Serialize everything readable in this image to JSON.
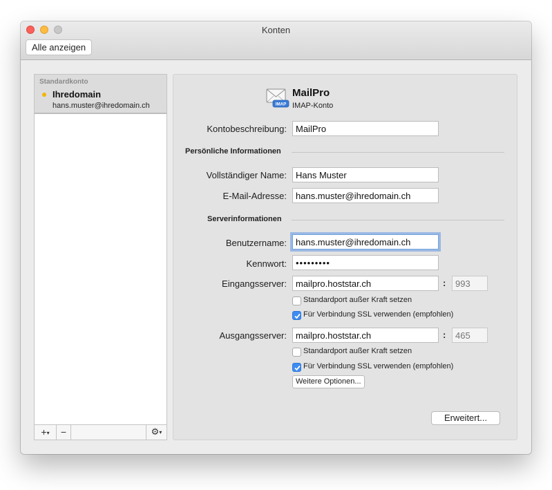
{
  "window": {
    "title": "Konten"
  },
  "toolbar": {
    "show_all_label": "Alle anzeigen"
  },
  "sidebar": {
    "section_label": "Standardkonto",
    "accounts": [
      {
        "name": "Ihredomain",
        "email": "hans.muster@ihredomain.ch",
        "status_color": "#f4b400"
      }
    ],
    "footer": {
      "add_label": "+",
      "remove_label": "−",
      "gear_icon": "gear-icon"
    }
  },
  "account": {
    "title": "MailPro",
    "type": "IMAP-Konto",
    "icon": "envelope-imap-icon",
    "icon_badge": "IMAP"
  },
  "form": {
    "description": {
      "label": "Kontobeschreibung:",
      "value": "MailPro"
    },
    "personal_heading": "Persönliche Informationen",
    "full_name": {
      "label": "Vollständiger Name:",
      "value": "Hans Muster"
    },
    "email": {
      "label": "E-Mail-Adresse:",
      "value": "hans.muster@ihredomain.ch"
    },
    "server_heading": "Serverinformationen",
    "username": {
      "label": "Benutzername:",
      "value": "hans.muster@ihredomain.ch"
    },
    "password": {
      "label": "Kennwort:",
      "value": "•••••••••"
    },
    "incoming": {
      "label": "Eingangsserver:",
      "value": "mailpro.hoststar.ch",
      "port_placeholder": "993",
      "override_port_label": "Standardport außer Kraft setzen",
      "override_port_checked": false,
      "ssl_label": "Für Verbindung SSL verwenden (empfohlen)",
      "ssl_checked": true
    },
    "outgoing": {
      "label": "Ausgangsserver:",
      "value": "mailpro.hoststar.ch",
      "port_placeholder": "465",
      "override_port_label": "Standardport außer Kraft setzen",
      "override_port_checked": false,
      "ssl_label": "Für Verbindung SSL verwenden (empfohlen)",
      "ssl_checked": true
    },
    "more_options_label": "Weitere Optionen...",
    "advanced_label": "Erweitert..."
  },
  "colors": {
    "accent": "#3d8cf2",
    "focus_ring": "#5f96e1"
  }
}
